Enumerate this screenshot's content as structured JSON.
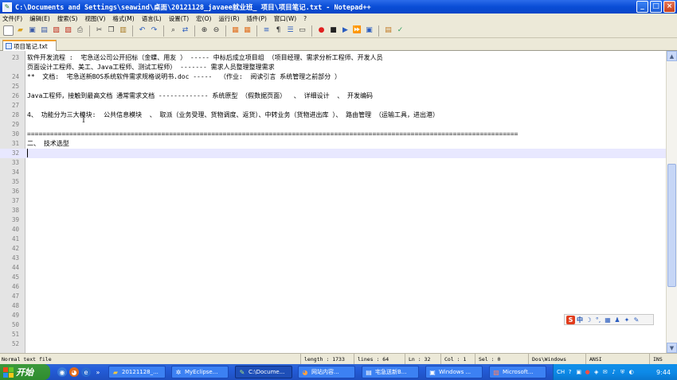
{
  "window": {
    "title": "C:\\Documents and Settings\\seawind\\桌面\\20121128_javaee就业班_ 项目\\项目笔记.txt - Notepad++",
    "minimize": "_",
    "restore": "□",
    "close": "×"
  },
  "menu": [
    "文件(F)",
    "编辑(E)",
    "搜索(S)",
    "视图(V)",
    "格式(M)",
    "语言(L)",
    "设置(T)",
    "宏(O)",
    "运行(R)",
    "插件(P)",
    "窗口(W)",
    "?"
  ],
  "toolbar_icons": [
    "new-icon",
    "open-icon",
    "save-icon",
    "save-all-icon",
    "close-icon",
    "close-all-icon",
    "print-icon",
    "cut-icon",
    "copy-icon",
    "paste-icon",
    "undo-icon",
    "redo-icon",
    "find-icon",
    "replace-icon",
    "zoom-in-icon",
    "zoom-out-icon",
    "sync-v-icon",
    "sync-h-icon",
    "wrap-icon",
    "all-chars-icon",
    "indent-guide-icon",
    "doc-map-icon",
    "record-macro-icon",
    "stop-record-icon",
    "play-macro-icon",
    "play-multiple-icon",
    "save-macro-icon",
    "run-icon",
    "spellcheck-icon"
  ],
  "tab": {
    "label": "项目笔记.txt"
  },
  "editor": {
    "lines": [
      {
        "num": "23",
        "text": "软件开发流程 :  宅急送公司公开招标（金蝶、用友 ） ----- 中标后成立项目组 （项目经理、需求分析工程师、开发人员"
      },
      {
        "num": "",
        "text": "页面设计工程师、美工、Java工程师、测试工程师） ------- 需求人员整理整理需求"
      },
      {
        "num": "24",
        "text": "**  文档:  宅急送新BOS系统软件需求规格说明书.doc -----  （作业:  阅读引言 系统管理之前部分 ）"
      },
      {
        "num": "25",
        "text": ""
      },
      {
        "num": "26",
        "text": "Java工程师，接触到最高文档 通常需求文档 ------------- 系统原型 （假数据页面）  、 详细设计  、 开发编码"
      },
      {
        "num": "27",
        "text": ""
      },
      {
        "num": "28",
        "text": "4、 功能分为三大模块:  公共信息模块  、 取派（业务受理、货物调度、返货）、中转业务（货物进出库 ）、 路由管理 （运输工具，进出港）"
      },
      {
        "num": "29",
        "text": ""
      },
      {
        "num": "30",
        "text": "================================================================================================================================"
      },
      {
        "num": "31",
        "text": "二、 技术选型"
      },
      {
        "num": "32",
        "text": ""
      },
      {
        "num": "33",
        "text": ""
      },
      {
        "num": "34",
        "text": ""
      },
      {
        "num": "35",
        "text": ""
      },
      {
        "num": "36",
        "text": ""
      },
      {
        "num": "37",
        "text": ""
      },
      {
        "num": "38",
        "text": ""
      },
      {
        "num": "39",
        "text": ""
      },
      {
        "num": "40",
        "text": ""
      },
      {
        "num": "41",
        "text": ""
      },
      {
        "num": "42",
        "text": ""
      },
      {
        "num": "43",
        "text": ""
      },
      {
        "num": "44",
        "text": ""
      },
      {
        "num": "45",
        "text": ""
      },
      {
        "num": "46",
        "text": ""
      },
      {
        "num": "47",
        "text": ""
      },
      {
        "num": "48",
        "text": ""
      },
      {
        "num": "49",
        "text": ""
      },
      {
        "num": "50",
        "text": ""
      },
      {
        "num": "51",
        "text": ""
      },
      {
        "num": "52",
        "text": ""
      }
    ],
    "current_line_index": 10
  },
  "ime": {
    "logo": "S",
    "mode": "中"
  },
  "status": {
    "file_type": "Normal text file",
    "length": "length : 1733",
    "lines": "lines : 64",
    "ln": "Ln : 32",
    "col": "Col : 1",
    "sel": "Sel : 0",
    "eol": "Dos\\Windows",
    "encoding": "ANSI",
    "ins": "INS"
  },
  "taskbar": {
    "start": "开始",
    "tasks": [
      {
        "label": "20121128_...",
        "icon": "folder-icon"
      },
      {
        "label": "MyEclipse...",
        "icon": "myeclipse-icon"
      },
      {
        "label": "C:\\Docume...",
        "icon": "notepad-icon"
      },
      {
        "label": "网站内容...",
        "icon": "firefox-icon"
      },
      {
        "label": "宅急送新B...",
        "icon": "document-icon"
      },
      {
        "label": "Windows ...",
        "icon": "windows-icon"
      },
      {
        "label": "Microsoft...",
        "icon": "powerpoint-icon"
      }
    ],
    "tray_lang": "CH",
    "clock": "9:44"
  }
}
